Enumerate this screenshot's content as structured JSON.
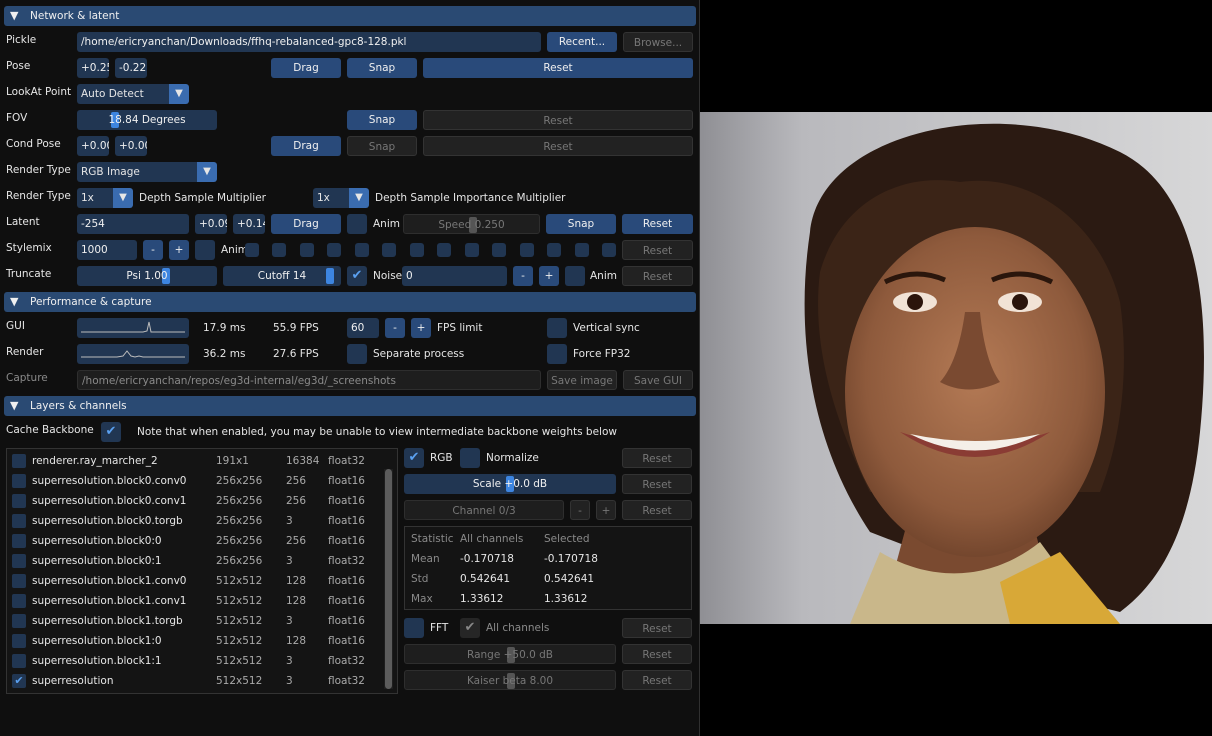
{
  "sections": {
    "network": "Network & latent",
    "performance": "Performance & capture",
    "layers": "Layers & channels"
  },
  "network": {
    "pickle_label": "Pickle",
    "pickle_value": "/home/ericryanchan/Downloads/ffhq-rebalanced-gpc8-128.pkl",
    "recent_btn": "Recent...",
    "browse_btn": "Browse...",
    "pose_label": "Pose",
    "pose_x": "+0.25",
    "pose_y": "-0.22",
    "drag_btn": "Drag",
    "snap_btn": "Snap",
    "reset_btn": "Reset",
    "lookat_label": "LookAt Point",
    "lookat_value": "Auto Detect",
    "fov_label": "FOV",
    "fov_value": "18.84 Degrees",
    "fov_fraction": 0.25,
    "cond_pose_label": "Cond Pose",
    "cond_x": "+0.00",
    "cond_y": "+0.00",
    "render_type_label": "Render Type",
    "render_type_value": "RGB Image",
    "depth_mult_value": "1x",
    "depth_mult_label": "Depth Sample Multiplier",
    "depth_imp_value": "1x",
    "depth_imp_label": "Depth Sample Importance Multiplier",
    "latent_label": "Latent",
    "latent_seed": "-254",
    "latent_x": "+0.09",
    "latent_y": "+0.14",
    "anim_label": "Anim",
    "speed_value": "Speed 0.250",
    "speed_fraction": 0.5,
    "stylemix_label": "Stylemix",
    "stylemix_value": "1000",
    "minus": "-",
    "plus": "+",
    "truncate_label": "Truncate",
    "psi_value": "Psi 1.00",
    "psi_fraction": 0.65,
    "cutoff_value": "Cutoff 14",
    "cutoff_fraction": 0.95,
    "noise_label": "Noise",
    "noise_value": "0"
  },
  "performance": {
    "gui_label": "GUI",
    "gui_ms": "17.9 ms",
    "gui_fps": "55.9 FPS",
    "fps_limit_value": "60",
    "fps_limit_label": "FPS limit",
    "vsync_label": "Vertical sync",
    "render_label": "Render",
    "render_ms": "36.2 ms",
    "render_fps": "27.6 FPS",
    "separate_label": "Separate process",
    "fp32_label": "Force FP32",
    "capture_label": "Capture",
    "capture_path": "/home/ericryanchan/repos/eg3d-internal/eg3d/_screenshots",
    "save_image_btn": "Save image",
    "save_gui_btn": "Save GUI"
  },
  "layers": {
    "cache_label": "Cache Backbone",
    "cache_note": "Note that when enabled, you may be unable to view intermediate backbone weights below",
    "rows": [
      {
        "name": "renderer.ray_marcher_2",
        "res": "191x1",
        "ch": "16384",
        "dtype": "float32",
        "checked": false
      },
      {
        "name": "superresolution.block0.conv0",
        "res": "256x256",
        "ch": "256",
        "dtype": "float16",
        "checked": false
      },
      {
        "name": "superresolution.block0.conv1",
        "res": "256x256",
        "ch": "256",
        "dtype": "float16",
        "checked": false
      },
      {
        "name": "superresolution.block0.torgb",
        "res": "256x256",
        "ch": "3",
        "dtype": "float16",
        "checked": false
      },
      {
        "name": "superresolution.block0:0",
        "res": "256x256",
        "ch": "256",
        "dtype": "float16",
        "checked": false
      },
      {
        "name": "superresolution.block0:1",
        "res": "256x256",
        "ch": "3",
        "dtype": "float32",
        "checked": false
      },
      {
        "name": "superresolution.block1.conv0",
        "res": "512x512",
        "ch": "128",
        "dtype": "float16",
        "checked": false
      },
      {
        "name": "superresolution.block1.conv1",
        "res": "512x512",
        "ch": "128",
        "dtype": "float16",
        "checked": false
      },
      {
        "name": "superresolution.block1.torgb",
        "res": "512x512",
        "ch": "3",
        "dtype": "float16",
        "checked": false
      },
      {
        "name": "superresolution.block1:0",
        "res": "512x512",
        "ch": "128",
        "dtype": "float16",
        "checked": false
      },
      {
        "name": "superresolution.block1:1",
        "res": "512x512",
        "ch": "3",
        "dtype": "float32",
        "checked": false
      },
      {
        "name": "superresolution",
        "res": "512x512",
        "ch": "3",
        "dtype": "float32",
        "checked": true
      }
    ],
    "rgb_label": "RGB",
    "normalize_label": "Normalize",
    "scale_value": "Scale +0.0 dB",
    "scale_fraction": 0.5,
    "channel_value": "Channel 0/3",
    "stats": {
      "headers": [
        "Statistic",
        "All channels",
        "Selected"
      ],
      "rows": [
        [
          "Mean",
          "-0.170718",
          "-0.170718"
        ],
        [
          "Std",
          "0.542641",
          "0.542641"
        ],
        [
          "Max",
          "1.33612",
          "1.33612"
        ]
      ]
    },
    "fft_label": "FFT",
    "all_channels_label": "All channels",
    "range_value": "Range +50.0 dB",
    "range_fraction": 0.5,
    "kaiser_value": "Kaiser beta 8.00",
    "kaiser_fraction": 0.5
  },
  "colors": {
    "header": "#2a4a73",
    "button": "#294a7a",
    "frame": "#213652",
    "accent": "#3d85e0",
    "check": "#5aa0f0"
  }
}
